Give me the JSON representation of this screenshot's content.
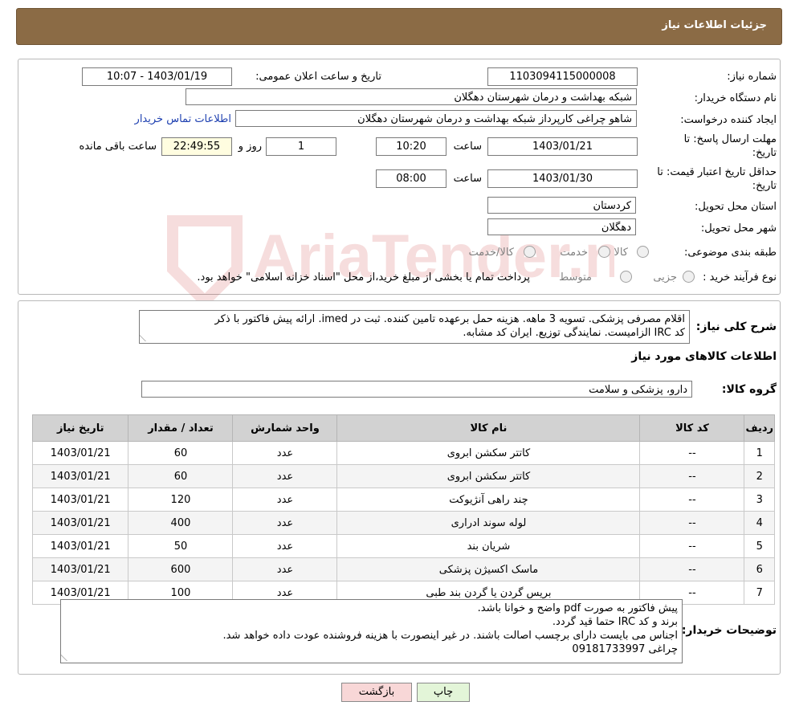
{
  "header": {
    "title": "جزئیات اطلاعات نیاز"
  },
  "form": {
    "need_number_label": "شماره نیاز:",
    "need_number": "1103094115000008",
    "announce_label": "تاریخ و ساعت اعلان عمومی:",
    "announce_value": "1403/01/19 - 10:07",
    "buyer_org_label": "نام دستگاه خریدار:",
    "buyer_org": "شبکه بهداشت و درمان شهرستان دهگلان",
    "creator_label": "ایجاد کننده درخواست:",
    "creator": "شاهو چراغی کارپرداز شبکه بهداشت و درمان شهرستان دهگلان",
    "contact_link": "اطلاعات تماس خریدار",
    "deadline_label_1": "مهلت ارسال پاسخ: تا",
    "deadline_label_2": "تاریخ:",
    "deadline_date": "1403/01/21",
    "time_label": "ساعت",
    "deadline_time": "10:20",
    "days_value": "1",
    "days_label": "روز و",
    "remaining_time": "22:49:55",
    "remaining_label": "ساعت باقی مانده",
    "validity_label_1": "حداقل تاریخ اعتبار قیمت: تا",
    "validity_label_2": "تاریخ:",
    "validity_date": "1403/01/30",
    "validity_time": "08:00",
    "province_label": "استان محل تحویل:",
    "province": "کردستان",
    "city_label": "شهر محل تحویل:",
    "city": "دهگلان",
    "category_label": "طبقه بندی موضوعی:",
    "category_options": [
      "کالا",
      "خدمت",
      "کالا/خدمت"
    ],
    "process_label": "نوع فرآیند خرید :",
    "process_options": [
      "جزیی",
      "متوسط"
    ],
    "process_note": "پرداخت تمام یا بخشی از مبلغ خرید،از محل \"اسناد خزانه اسلامی\" خواهد بود."
  },
  "summary": {
    "label": "شرح کلی نیاز:",
    "line1": "اقلام مصرفی پزشکی. تسویه 3 ماهه. هزینه حمل برعهده تامین کننده. ثبت در imed. ارائه پیش فاکتور با ذکر",
    "line2": "کد IRC الزامیست. نمایندگی توزیع. ایران کد مشابه.",
    "goods_info_title": "اطلاعات کالاهای مورد نیاز",
    "group_label": "گروه کالا:",
    "group_value": "دارو، پزشکی و سلامت"
  },
  "table": {
    "headers": [
      "ردیف",
      "کد کالا",
      "نام کالا",
      "واحد شمارش",
      "تعداد / مقدار",
      "تاریخ نیاز"
    ],
    "rows": [
      [
        "1",
        "--",
        "کاتتر سکشن ابروی",
        "عدد",
        "60",
        "1403/01/21"
      ],
      [
        "2",
        "--",
        "کاتتر سکشن ابروی",
        "عدد",
        "60",
        "1403/01/21"
      ],
      [
        "3",
        "--",
        "چند راهی آنژیوکت",
        "عدد",
        "120",
        "1403/01/21"
      ],
      [
        "4",
        "--",
        "لوله سوند ادراری",
        "عدد",
        "400",
        "1403/01/21"
      ],
      [
        "5",
        "--",
        "شریان بند",
        "عدد",
        "50",
        "1403/01/21"
      ],
      [
        "6",
        "--",
        "ماسک اکسیژن پزشکی",
        "عدد",
        "600",
        "1403/01/21"
      ],
      [
        "7",
        "--",
        "بریس گردن یا گردن بند طبی",
        "عدد",
        "100",
        "1403/01/21"
      ]
    ]
  },
  "buyer_notes": {
    "label": "توضیحات خریدار:",
    "lines": [
      "پیش فاکتور به صورت pdf واضح و خوانا باشد.",
      "برند و کد IRC حتما قید گردد.",
      "اجناس می بایست دارای برچسب اصالت باشند. در غیر اینصورت با هزینه فروشنده عودت داده خواهد شد.",
      "چراغی 09181733997"
    ]
  },
  "buttons": {
    "print": "چاپ",
    "back": "بازگشت"
  },
  "colors": {
    "header_bg": "#8b6b45",
    "link": "#1d3fb0",
    "back_btn": "#f8d7d7",
    "print_btn": "#e3f5d8"
  },
  "watermark": {
    "text": "AriaTender.neT"
  }
}
